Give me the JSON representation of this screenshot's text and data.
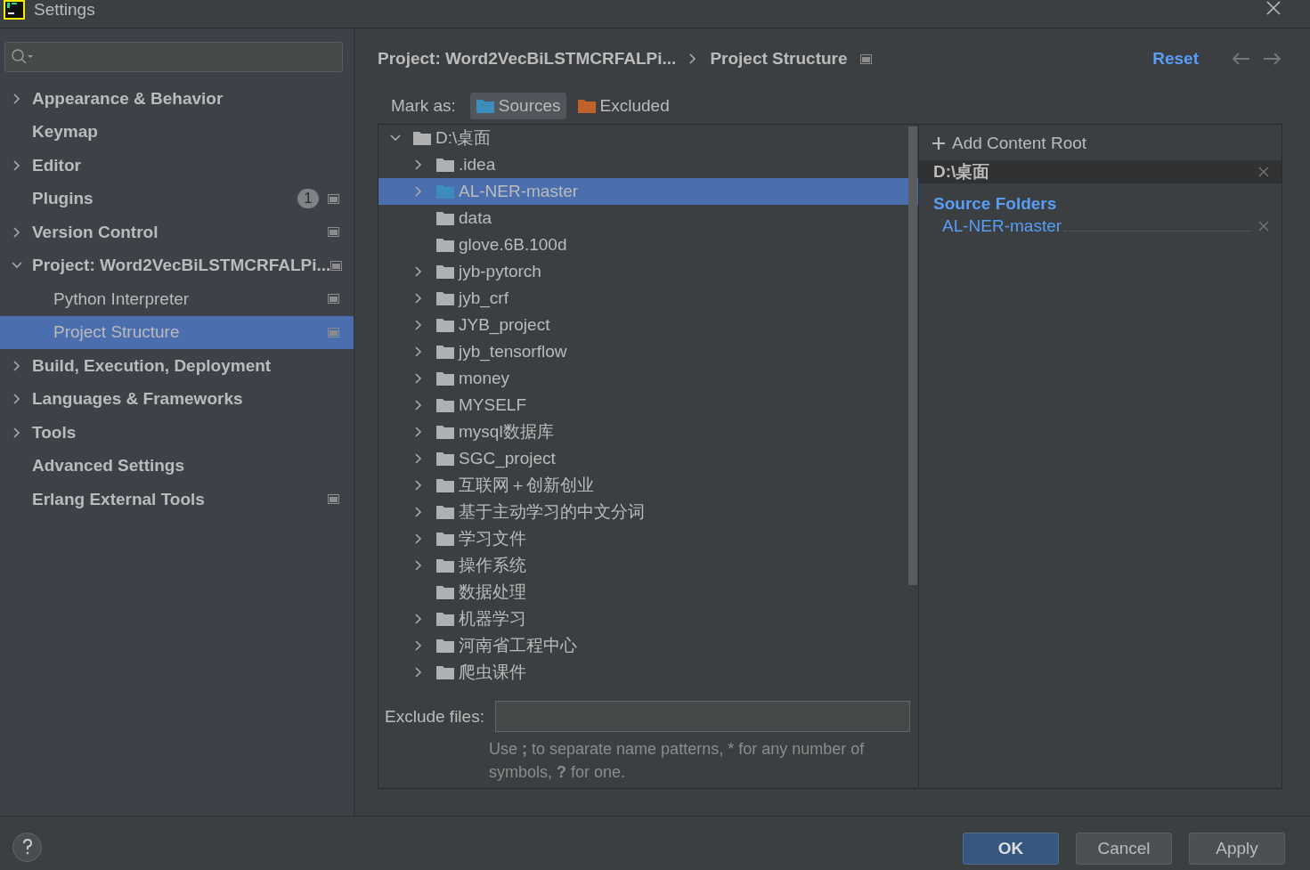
{
  "window": {
    "title": "Settings"
  },
  "sidebar": {
    "items": [
      {
        "label": "Appearance & Behavior",
        "expandable": true,
        "expanded": false,
        "selected": false,
        "project_level": false
      },
      {
        "label": "Keymap",
        "expandable": false,
        "selected": false,
        "project_level": false
      },
      {
        "label": "Editor",
        "expandable": true,
        "expanded": false,
        "selected": false,
        "project_level": false
      },
      {
        "label": "Plugins",
        "expandable": false,
        "selected": false,
        "project_level": true,
        "badge": "1"
      },
      {
        "label": "Version Control",
        "expandable": true,
        "expanded": false,
        "selected": false,
        "project_level": true
      },
      {
        "label": "Project: Word2VecBiLSTMCRFALPi...",
        "expandable": true,
        "expanded": true,
        "selected": false,
        "project_level": true,
        "children": [
          {
            "label": "Python Interpreter",
            "expandable": false,
            "selected": false,
            "project_level": true
          },
          {
            "label": "Project Structure",
            "expandable": false,
            "selected": true,
            "project_level": true
          }
        ]
      },
      {
        "label": "Build, Execution, Deployment",
        "expandable": true,
        "expanded": false,
        "selected": false,
        "project_level": false
      },
      {
        "label": "Languages & Frameworks",
        "expandable": true,
        "expanded": false,
        "selected": false,
        "project_level": false
      },
      {
        "label": "Tools",
        "expandable": true,
        "expanded": false,
        "selected": false,
        "project_level": false
      },
      {
        "label": "Advanced Settings",
        "expandable": false,
        "selected": false,
        "project_level": false
      },
      {
        "label": "Erlang External Tools",
        "expandable": false,
        "selected": false,
        "project_level": true
      }
    ]
  },
  "header": {
    "breadcrumbs": [
      "Project: Word2VecBiLSTMCRFALPi...",
      "Project Structure"
    ],
    "reset": "Reset"
  },
  "mark_as": {
    "label": "Mark as:",
    "options": [
      {
        "label": "Sources",
        "kind": "sources",
        "selected": true
      },
      {
        "label": "Excluded",
        "kind": "excluded",
        "selected": false
      }
    ]
  },
  "tree": [
    {
      "label": "D:\\桌面",
      "expandable": true,
      "expanded": true,
      "source": false,
      "selected": false,
      "children": [
        {
          "label": ".idea",
          "expandable": true,
          "expanded": false,
          "source": false,
          "selected": false
        },
        {
          "label": "AL-NER-master",
          "expandable": true,
          "expanded": false,
          "source": true,
          "selected": true
        },
        {
          "label": "data",
          "expandable": false,
          "source": false,
          "selected": false
        },
        {
          "label": "glove.6B.100d",
          "expandable": false,
          "source": false,
          "selected": false
        },
        {
          "label": "jyb-pytorch",
          "expandable": true,
          "expanded": false,
          "source": false,
          "selected": false
        },
        {
          "label": "jyb_crf",
          "expandable": true,
          "expanded": false,
          "source": false,
          "selected": false
        },
        {
          "label": "JYB_project",
          "expandable": true,
          "expanded": false,
          "source": false,
          "selected": false
        },
        {
          "label": "jyb_tensorflow",
          "expandable": true,
          "expanded": false,
          "source": false,
          "selected": false
        },
        {
          "label": "money",
          "expandable": true,
          "expanded": false,
          "source": false,
          "selected": false
        },
        {
          "label": "MYSELF",
          "expandable": true,
          "expanded": false,
          "source": false,
          "selected": false
        },
        {
          "label": "mysql数据库",
          "expandable": true,
          "expanded": false,
          "source": false,
          "selected": false
        },
        {
          "label": "SGC_project",
          "expandable": true,
          "expanded": false,
          "source": false,
          "selected": false
        },
        {
          "label": "互联网＋创新创业",
          "expandable": true,
          "expanded": false,
          "source": false,
          "selected": false
        },
        {
          "label": "基于主动学习的中文分词",
          "expandable": true,
          "expanded": false,
          "source": false,
          "selected": false
        },
        {
          "label": "学习文件",
          "expandable": true,
          "expanded": false,
          "source": false,
          "selected": false
        },
        {
          "label": "操作系统",
          "expandable": true,
          "expanded": false,
          "source": false,
          "selected": false
        },
        {
          "label": "数据处理",
          "expandable": false,
          "source": false,
          "selected": false
        },
        {
          "label": "机器学习",
          "expandable": true,
          "expanded": false,
          "source": false,
          "selected": false
        },
        {
          "label": "河南省工程中心",
          "expandable": true,
          "expanded": false,
          "source": false,
          "selected": false
        },
        {
          "label": "爬虫课件",
          "expandable": true,
          "expanded": false,
          "source": false,
          "selected": false
        }
      ]
    }
  ],
  "exclude_files": {
    "label": "Exclude files:",
    "hint": "Use **;** to separate name patterns, * for any number of symbols, **?** for one."
  },
  "content_roots": {
    "add_label": "Add Content Root",
    "roots": [
      {
        "path": "D:\\桌面",
        "section_title": "Source Folders",
        "folders": [
          "AL-NER-master"
        ]
      }
    ]
  },
  "buttons": [
    {
      "label": "OK",
      "kind": "primary"
    },
    {
      "label": "Cancel",
      "kind": "normal"
    },
    {
      "label": "Apply",
      "kind": "normal"
    }
  ]
}
